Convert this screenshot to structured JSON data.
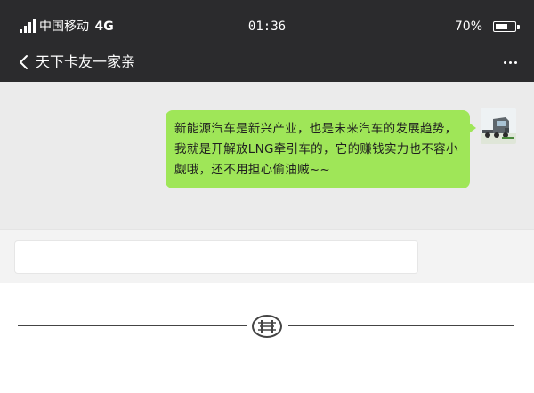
{
  "status_bar": {
    "carrier": "中国移动",
    "network": "4G",
    "time": "01:36",
    "battery_percent_label": "70%",
    "battery_level": 0.7,
    "signal_icon": "signal-bars-icon",
    "battery_icon": "battery-icon"
  },
  "nav": {
    "back_icon": "chevron-left-icon",
    "title": "天下卡友一家亲",
    "more_icon": "more-dots-icon"
  },
  "messages": [
    {
      "side": "right",
      "text": "新能源汽车是新兴产业，也是未来汽车的发展趋势，我就是开解放LNG牵引车的，它的赚钱实力也不容小觑哦，还不用担心偷油贼~~",
      "avatar_icon": "truck-avatar"
    }
  ],
  "input": {
    "value": "",
    "placeholder": ""
  },
  "footer": {
    "logo_icon": "faw-logo-icon"
  },
  "colors": {
    "bar_background": "#2b2b2d",
    "chat_background": "#ebebeb",
    "bubble": "#9fe658",
    "input_bar": "#f3f3f3"
  }
}
